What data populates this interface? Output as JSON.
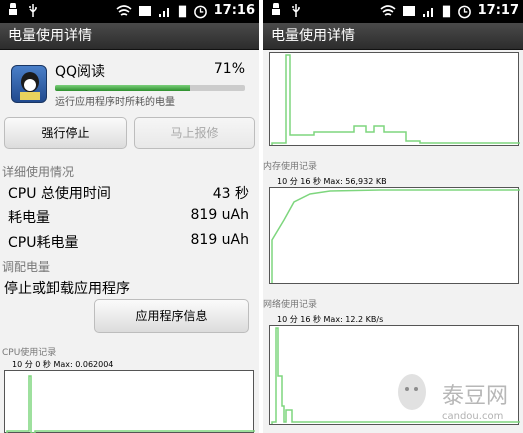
{
  "left_screen": {
    "status_bar": {
      "time": "17:16"
    },
    "title": "电量使用详情",
    "app": {
      "name": "QQ阅读",
      "percent": "71%",
      "usage_fraction": 0.71,
      "description": "运行应用程序时所耗的电量"
    },
    "buttons": {
      "force_stop": "强行停止",
      "report": "马上报修"
    },
    "details_header": "详细使用情况",
    "details": [
      {
        "label": "CPU 总使用时间",
        "value": "43 秒"
      },
      {
        "label": "耗电量",
        "value": "819 uAh"
      },
      {
        "label": "CPU耗电量",
        "value": "819 uAh"
      }
    ],
    "adjust_header": "调配电量",
    "adjust_text": "停止或卸载应用程序",
    "app_info_button": "应用程序信息",
    "cpu_graph": {
      "label": "CPU使用记录",
      "max_text": "10 分 0 秒 Max: 0.062004"
    }
  },
  "right_screen": {
    "status_bar": {
      "time": "17:17"
    },
    "title": "电量使用详情",
    "memory_graph": {
      "label": "内存使用记录",
      "max_text": "10 分 16 秒 Max: 56,932 KB"
    },
    "network_graph": {
      "label": "网络使用记录",
      "max_text": "10 分 16 秒 Max: 12.2 KB/s"
    }
  },
  "watermark": {
    "text": "泰豆网",
    "url": "candou.com"
  },
  "colors": {
    "graph_line": "#7ed67e",
    "progress": "#3a9a3a"
  }
}
